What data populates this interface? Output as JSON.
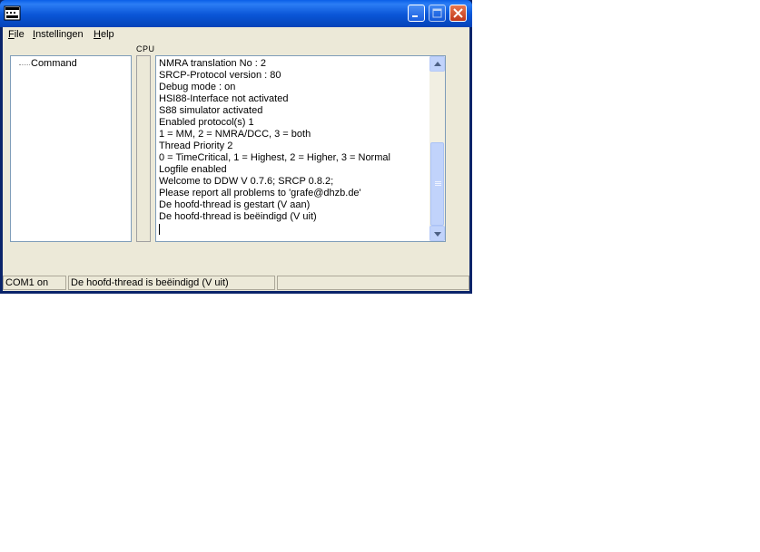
{
  "window": {
    "icon": "app-icon",
    "controls": [
      "minimize-icon",
      "maximize-icon",
      "close-icon"
    ]
  },
  "menu": {
    "file": {
      "accel": "F",
      "rest": "ile"
    },
    "instellingen": {
      "accel": "I",
      "rest": "nstellingen"
    },
    "help": {
      "accel": "H",
      "rest": "elp"
    }
  },
  "cpu_label": "CPU",
  "tree": {
    "items": [
      "Command"
    ]
  },
  "log": {
    "lines": [
      "NMRA translation No : 2",
      "SRCP-Protocol version : 80",
      "Debug mode : on",
      "HSI88-Interface not activated",
      "S88 simulator activated",
      "Enabled protocol(s) 1",
      "1 = MM, 2 = NMRA/DCC, 3 = both",
      "Thread Priority 2",
      "0 = TimeCritical, 1 = Highest, 2 = Higher, 3 = Normal",
      "Logfile enabled",
      "Welcome to DDW V 0.7.6; SRCP 0.8.2;",
      "Please report all problems to 'grafe@dhzb.de'",
      "De hoofd-thread is gestart (V aan)",
      "De hoofd-thread is beëindigd (V uit)"
    ]
  },
  "status": {
    "port": "COM1 on",
    "message": "De hoofd-thread is beëindigd (V uit)",
    "extra": ""
  }
}
